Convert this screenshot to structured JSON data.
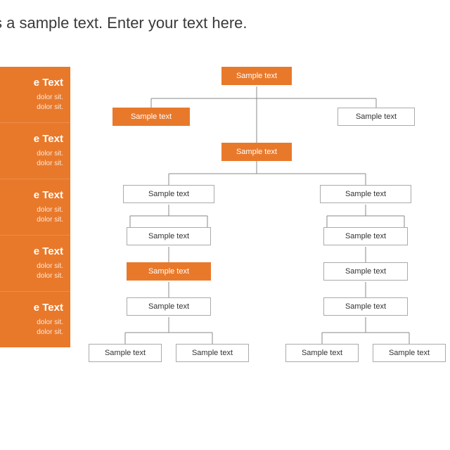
{
  "title": "s is a sample text. Enter your text here.",
  "sidebar": {
    "items": [
      {
        "title": "e Text",
        "body1": "dolor sit.",
        "body2": "dolor sit."
      },
      {
        "title": "e Text",
        "body1": "dolor sit.",
        "body2": "dolor sit."
      },
      {
        "title": "e Text",
        "body1": "dolor sit.",
        "body2": "dolor sit."
      },
      {
        "title": "e Text",
        "body1": "dolor sit.",
        "body2": "dolor sit."
      },
      {
        "title": "e Text",
        "body1": "dolor sit.",
        "body2": "dolor sit."
      }
    ]
  },
  "nodes": {
    "n1": "Sample text",
    "n2": "Sample text",
    "n3": "Sample text",
    "n4": "Sample text",
    "n5": "Sample text",
    "n6": "Sample text",
    "n7": "Sample text",
    "n8": "Sample text",
    "n9": "Sample text",
    "n10": "Sample text",
    "n11": "Sample text",
    "n12": "Sample text",
    "n13": "Sample text",
    "n14": "Sample text",
    "n15": "Sample text"
  },
  "colors": {
    "accent": "#e8792b"
  }
}
